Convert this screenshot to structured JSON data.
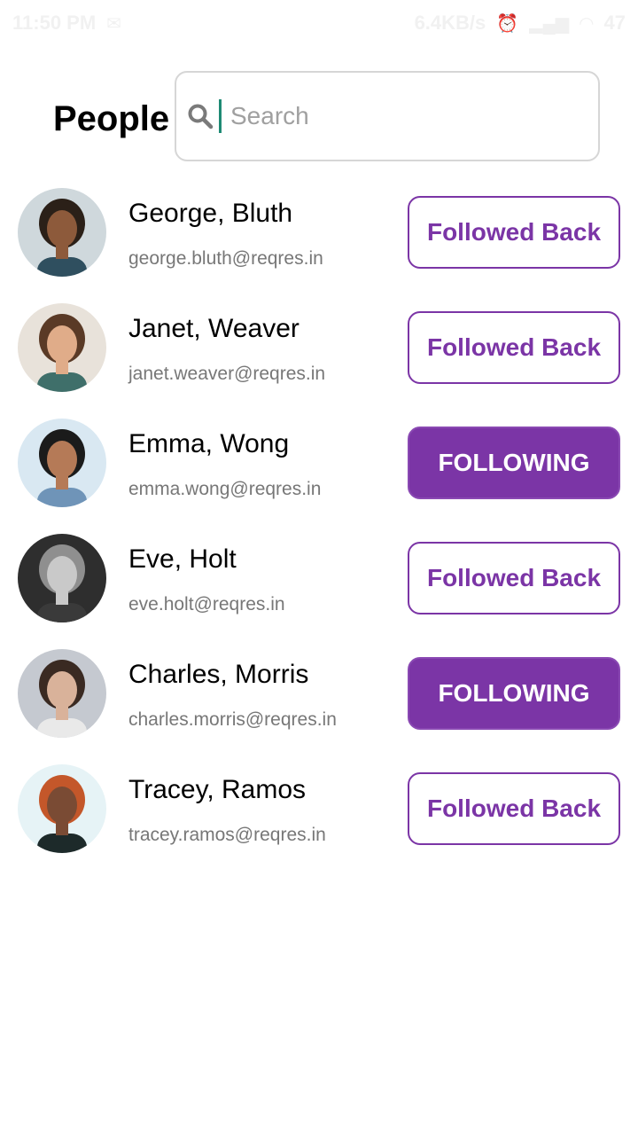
{
  "status_bar": {
    "time": "11:50 PM",
    "speed": "6.4KB/s",
    "battery": "47"
  },
  "header": {
    "title": "People",
    "search": {
      "placeholder": "Search",
      "value": ""
    }
  },
  "colors": {
    "accent": "#7b35a6",
    "caret": "#1e8a74"
  },
  "people": [
    {
      "name": "George, Bluth",
      "email": "george.bluth@reqres.in",
      "button": "Followed Back",
      "button_style": "outline",
      "avatar": {
        "bg": "#cfd8dc",
        "skin": "#8d5a3b",
        "hair": "#2b2018",
        "shirt": "#2f4f5f"
      }
    },
    {
      "name": "Janet, Weaver",
      "email": "janet.weaver@reqres.in",
      "button": "Followed Back",
      "button_style": "outline",
      "avatar": {
        "bg": "#e8e2da",
        "skin": "#e0ac89",
        "hair": "#5a3a26",
        "shirt": "#3f6f6a"
      }
    },
    {
      "name": "Emma, Wong",
      "email": "emma.wong@reqres.in",
      "button": "FOLLOWING",
      "button_style": "filled",
      "avatar": {
        "bg": "#d9e8f2",
        "skin": "#b57a57",
        "hair": "#1b1b1b",
        "shirt": "#6f94b8"
      }
    },
    {
      "name": "Eve, Holt",
      "email": "eve.holt@reqres.in",
      "button": "Followed Back",
      "button_style": "outline",
      "avatar": {
        "bg": "#2e2e2e",
        "skin": "#c9c9c9",
        "hair": "#8f8f8f",
        "shirt": "#3a3a3a"
      }
    },
    {
      "name": "Charles, Morris",
      "email": "charles.morris@reqres.in",
      "button": "FOLLOWING",
      "button_style": "filled",
      "avatar": {
        "bg": "#c5c9d0",
        "skin": "#d9b29a",
        "hair": "#3a2a22",
        "shirt": "#e9e9e9"
      }
    },
    {
      "name": "Tracey, Ramos",
      "email": "tracey.ramos@reqres.in",
      "button": "Followed Back",
      "button_style": "outline",
      "avatar": {
        "bg": "#e6f3f6",
        "skin": "#7a4b34",
        "hair": "#c4572a",
        "shirt": "#1d2a2a"
      }
    }
  ]
}
